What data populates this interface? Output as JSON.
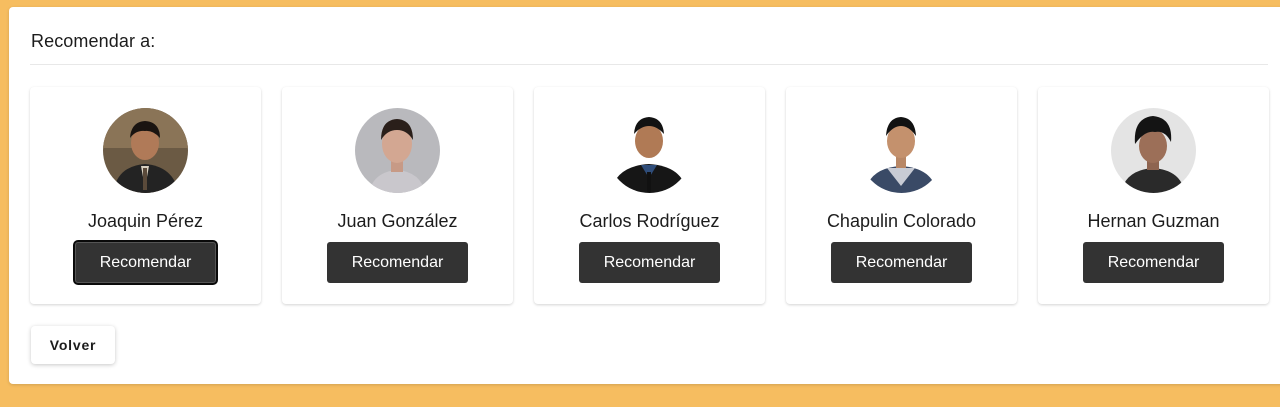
{
  "panel": {
    "title": "Recomendar a:"
  },
  "people": [
    {
      "name": "Joaquin Pérez",
      "button_label": "Recomendar",
      "photo": "person-photo-icon"
    },
    {
      "name": "Juan González",
      "button_label": "Recomendar",
      "photo": "person-photo-icon"
    },
    {
      "name": "Carlos Rodríguez",
      "button_label": "Recomendar",
      "photo": "person-photo-icon"
    },
    {
      "name": "Chapulin Colorado",
      "button_label": "Recomendar",
      "photo": "person-photo-icon"
    },
    {
      "name": "Hernan Guzman",
      "button_label": "Recomendar",
      "photo": "person-photo-icon"
    }
  ],
  "actions": {
    "back_label": "Volver"
  },
  "colors": {
    "background": "#f6bd60",
    "button": "#333333"
  }
}
